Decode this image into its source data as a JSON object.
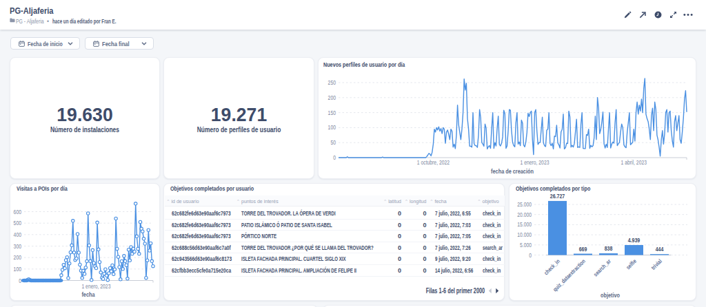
{
  "header": {
    "title": "PG-Aljaferia",
    "breadcrumb": "PG - Aljaferia",
    "separator": "•",
    "edited_info": "hace un día editado por Fran E.",
    "toolbar_icons": [
      "edit",
      "open-in-new",
      "history",
      "fullscreen",
      "more"
    ]
  },
  "filters": [
    {
      "label": "Fecha de inicio"
    },
    {
      "label": "Fecha final"
    }
  ],
  "kpis": [
    {
      "value": "19.630",
      "label": "Número de instalaciones"
    },
    {
      "value": "19.271",
      "label": "Número de perfiles de usuario"
    }
  ],
  "colors": {
    "accent_blue": "#4a90e2",
    "navy_text": "#3e4c6a",
    "axis_gray": "#7d88a0",
    "page_bg": "#f4f6f9"
  },
  "chart_data": [
    {
      "id": "nuevos_perfiles",
      "type": "line",
      "title": "Nuevos perfiles de usuario por día",
      "xlabel": "fecha de creación",
      "ylabel": "",
      "ylim": [
        0,
        250
      ],
      "yticks": [
        {
          "v": 0,
          "label": "0"
        },
        {
          "v": 50,
          "label": "50"
        },
        {
          "v": 100,
          "label": "100"
        },
        {
          "v": 150,
          "label": "150"
        },
        {
          "v": 200,
          "label": "200"
        },
        {
          "v": 250,
          "label": "250"
        }
      ],
      "xticks": [
        {
          "i": 86,
          "label": "1 octubre, 2022"
        },
        {
          "i": 178,
          "label": "1 enero, 2023"
        },
        {
          "i": 268,
          "label": "1 abril, 2023"
        }
      ],
      "legend": "off",
      "grid": "dashed-y",
      "markers": false,
      "values": [
        0,
        0,
        0,
        0,
        0,
        0,
        0,
        0,
        3,
        0,
        0,
        0,
        0,
        0,
        0,
        0,
        0,
        0,
        0,
        0,
        0,
        0,
        0,
        0,
        0,
        0,
        0,
        0,
        0,
        0,
        0,
        0,
        0,
        0,
        0,
        0,
        0,
        0,
        0,
        0,
        2,
        0,
        0,
        0,
        0,
        0,
        0,
        0,
        0,
        0,
        0,
        0,
        0,
        0,
        0,
        0,
        0,
        0,
        0,
        0,
        0,
        0,
        0,
        0,
        0,
        0,
        0,
        0,
        0,
        0,
        0,
        0,
        0,
        0,
        0,
        0,
        0,
        0,
        0,
        0,
        3,
        8,
        14,
        12,
        6,
        18,
        45,
        95,
        85,
        100,
        92,
        103,
        88,
        97,
        80,
        100,
        95,
        48,
        85,
        92,
        78,
        60,
        95,
        88,
        35,
        45,
        30,
        75,
        175,
        110,
        85,
        60,
        95,
        150,
        262,
        225,
        248,
        130,
        95,
        38,
        38,
        35,
        150,
        47,
        40,
        40,
        34,
        74,
        160,
        133,
        50,
        45,
        38,
        112,
        98,
        29,
        36,
        40,
        31,
        97,
        150,
        31,
        50,
        39,
        98,
        138,
        44,
        39,
        48,
        69,
        158,
        146,
        31,
        39,
        90,
        160,
        158,
        90,
        51,
        40,
        36,
        116,
        150,
        45,
        52,
        40,
        125,
        115,
        42,
        36,
        52,
        84,
        148,
        137,
        150,
        155,
        60,
        10,
        150,
        160,
        90,
        44,
        50,
        51,
        95,
        135,
        49,
        40,
        37,
        91,
        95,
        150,
        47,
        40,
        48,
        29,
        72,
        70,
        108,
        49,
        43,
        32,
        86,
        94,
        145,
        29,
        33,
        48,
        47,
        155,
        136,
        35,
        41,
        35,
        46,
        85,
        128,
        34,
        36,
        34,
        111,
        150,
        31,
        30,
        30,
        77,
        74,
        95,
        31,
        41,
        36,
        40,
        67,
        138,
        60,
        200,
        165,
        80,
        93,
        118,
        152,
        46,
        32,
        45,
        34,
        94,
        150,
        32,
        45,
        52,
        48,
        116,
        160,
        40,
        46,
        51,
        85,
        112,
        100,
        43,
        36,
        33,
        84,
        116,
        150,
        43,
        47,
        51,
        95,
        55,
        150,
        185,
        145,
        175,
        155,
        195,
        150,
        230,
        264,
        145,
        130,
        120,
        95,
        60,
        140,
        165,
        90,
        185,
        160,
        75,
        60,
        35,
        5,
        60,
        90,
        45,
        80,
        150,
        160,
        85,
        150,
        155,
        90,
        55,
        35,
        120,
        140,
        90,
        115,
        140,
        60,
        48,
        85,
        130,
        195,
        223,
        152
      ]
    },
    {
      "id": "visitas_pois",
      "type": "line",
      "title": "Visitas a POIs por día",
      "xlabel": "fecha",
      "ylabel": "",
      "ylim": [
        0,
        600
      ],
      "yticks": [
        {
          "v": 0,
          "label": "0"
        },
        {
          "v": 100,
          "label": "100"
        },
        {
          "v": 200,
          "label": "200"
        },
        {
          "v": 300,
          "label": "300"
        },
        {
          "v": 400,
          "label": "400"
        },
        {
          "v": 500,
          "label": "500"
        },
        {
          "v": 600,
          "label": "600"
        }
      ],
      "xticks": [
        {
          "i": 62,
          "label": "1 enero, 2023"
        }
      ],
      "legend": "off",
      "grid": "dashed-y",
      "markers": true,
      "values": [
        0,
        0,
        0,
        6,
        10,
        5,
        0,
        0,
        0,
        0,
        0,
        0,
        0,
        0,
        0,
        0,
        0,
        0,
        0,
        0,
        0,
        0,
        0,
        0,
        0,
        0,
        0,
        0,
        0,
        0,
        0,
        0,
        46,
        93,
        136,
        107,
        177,
        203,
        21,
        149,
        246,
        307,
        520,
        244,
        179,
        192,
        405,
        243,
        138,
        86,
        22,
        85,
        57,
        113,
        168,
        585,
        306,
        169,
        4,
        265,
        153,
        124,
        108,
        505,
        271,
        161,
        70,
        24,
        14,
        59,
        98,
        43,
        5,
        63,
        108,
        80,
        132,
        56,
        97,
        540,
        276,
        206,
        117,
        10,
        168,
        100,
        214,
        169,
        134,
        16,
        269,
        175,
        291,
        232,
        277,
        251,
        670,
        385,
        276,
        232,
        510,
        451,
        428,
        364,
        321,
        23,
        176,
        440,
        261,
        324,
        169,
        125
      ]
    },
    {
      "id": "objetivos_por_tipo",
      "type": "bar",
      "title": "Objetivos completados por tipo",
      "xlabel": "objetivo",
      "ylabel": "",
      "ylim": [
        0,
        25000
      ],
      "yticks": [
        {
          "v": 0,
          "label": "0"
        },
        {
          "v": 5000,
          "label": "5.000"
        },
        {
          "v": 10000,
          "label": "10.000"
        },
        {
          "v": 15000,
          "label": "15.000"
        },
        {
          "v": 20000,
          "label": "20.000"
        },
        {
          "v": 25000,
          "label": "25.000"
        }
      ],
      "categories": [
        "check_in",
        "quiz_dataextraction",
        "search_ar",
        "selfie",
        "trivial"
      ],
      "values": [
        26727,
        669,
        838,
        4939,
        444
      ],
      "value_labels": [
        "26.727",
        "669",
        "838",
        "4.939",
        "444"
      ],
      "legend": "off",
      "grid": "dashed-y"
    },
    {
      "id": "objetivos_por_usuario",
      "type": "table",
      "title": "Objetivos completados por usuario",
      "headers": [
        "id de usuario",
        "puntos de interés",
        "latitud",
        "longitud",
        "fecha",
        "objetivo"
      ],
      "rows": [
        [
          "62c682fe6d63e90aaf6c7973",
          "TORRE DEL TROVADOR. LA ÓPERA DE VERDI",
          "0",
          "0",
          "7 julio, 2022, 6:55",
          "check_in"
        ],
        [
          "62c682fe6d63e90aaf6c7973",
          "PATIO ISLÁMICO Ó PATIO DE SANTA ISABEL",
          "0",
          "0",
          "7 julio, 2022, 7:03",
          "check_in"
        ],
        [
          "62c682fe6d63e90aaf6c7973",
          "PÓRTICO NORTE",
          "0",
          "0",
          "7 julio, 2022, 7:05",
          "check_in"
        ],
        [
          "62c688c56d63e90aaf6c7a0f",
          "TORRE DEL TROVADOR ¿POR QUÉ SE LLAMA DEL TROVADOR?",
          "0",
          "0",
          "7 julio, 2022, 7:26",
          "search_ar"
        ],
        [
          "62c943566d63e90aaf6c8173",
          "ISLETA FACHADA PRINCIPAL. CUARTEL SIGLO XIX",
          "0",
          "0",
          "9 julio, 2022, 9:20",
          "check_in"
        ],
        [
          "62cfbb3ecc5cfe0a715e20ca",
          "ISLETA FACHADA PRINCIPAL. AMPLIACIÓN DE FELIPE II",
          "0",
          "0",
          "14 julio, 2022, 6:56",
          "check_in"
        ]
      ],
      "footer": "Filas 1-6 del primer 2000"
    }
  ]
}
